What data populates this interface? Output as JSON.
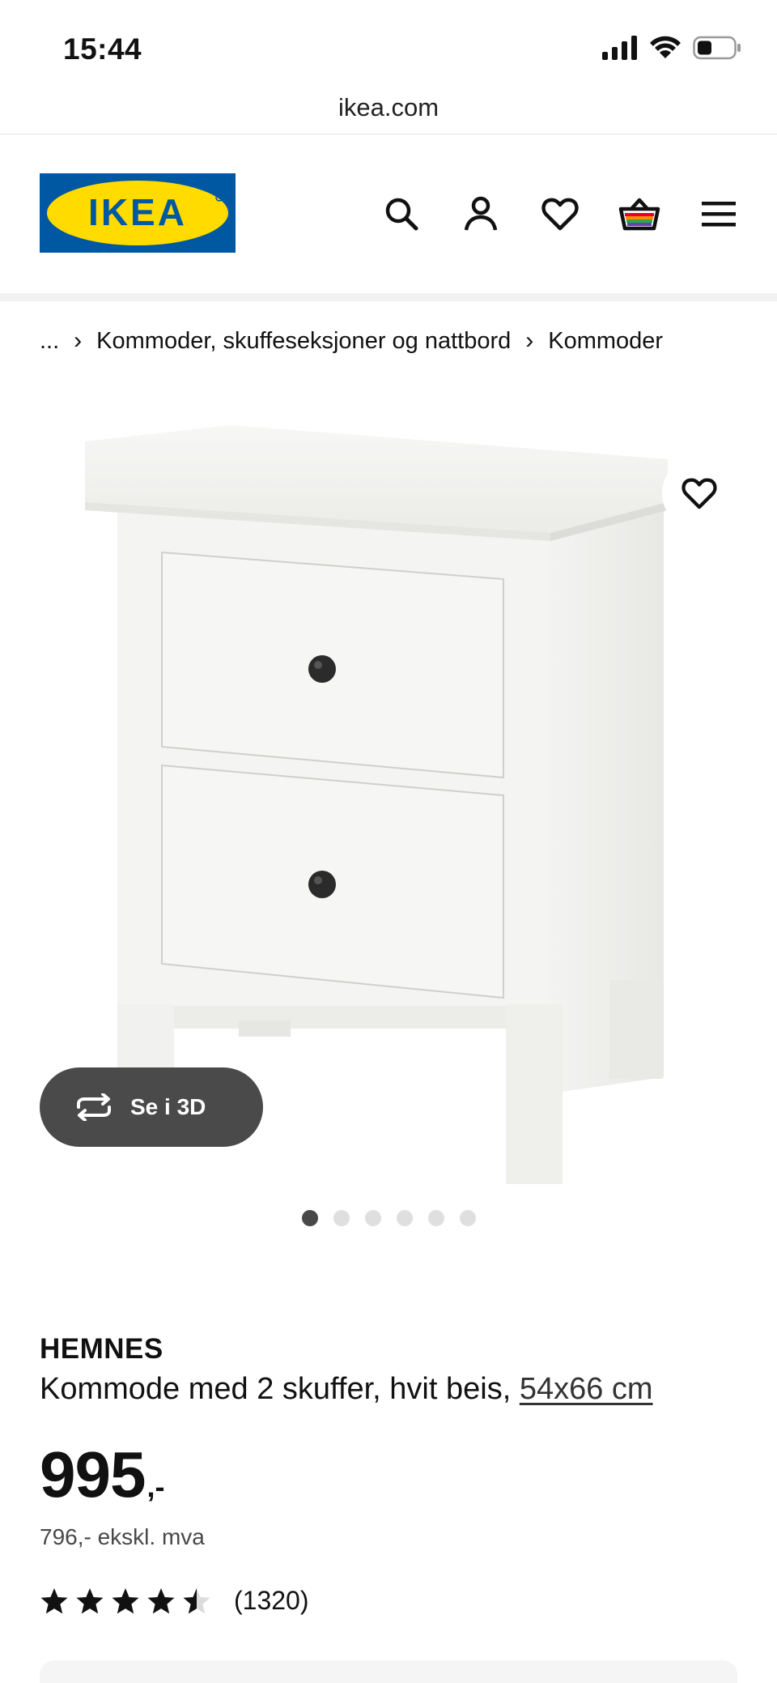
{
  "status_bar": {
    "time": "15:44",
    "icons": [
      "cellular-signal-icon",
      "wifi-icon",
      "battery-icon"
    ]
  },
  "browser": {
    "url": "ikea.com"
  },
  "header": {
    "logo_text": "IKEA",
    "icons": [
      "search-icon",
      "account-icon",
      "favorites-icon",
      "basket-icon",
      "menu-icon"
    ]
  },
  "breadcrumb": {
    "ellipsis": "...",
    "items": [
      "Kommoder, skuffeseksjoner og nattbord",
      "Kommoder"
    ]
  },
  "gallery": {
    "view_3d_label": "Se i 3D",
    "dots_total": 6,
    "active_dot": 1
  },
  "product": {
    "name": "HEMNES",
    "description": "Kommode med 2 skuffer, hvit beis,",
    "size_link": "54x66 cm",
    "price": "995",
    "price_suffix": ",-",
    "price_ex_vat": "796,- ekskl. mva",
    "rating": 4.5,
    "review_count": "(1320)"
  },
  "colors": {
    "ikea_blue": "#0058a3",
    "ikea_yellow": "#ffdb00",
    "pill_bg": "#4a4a4a"
  }
}
